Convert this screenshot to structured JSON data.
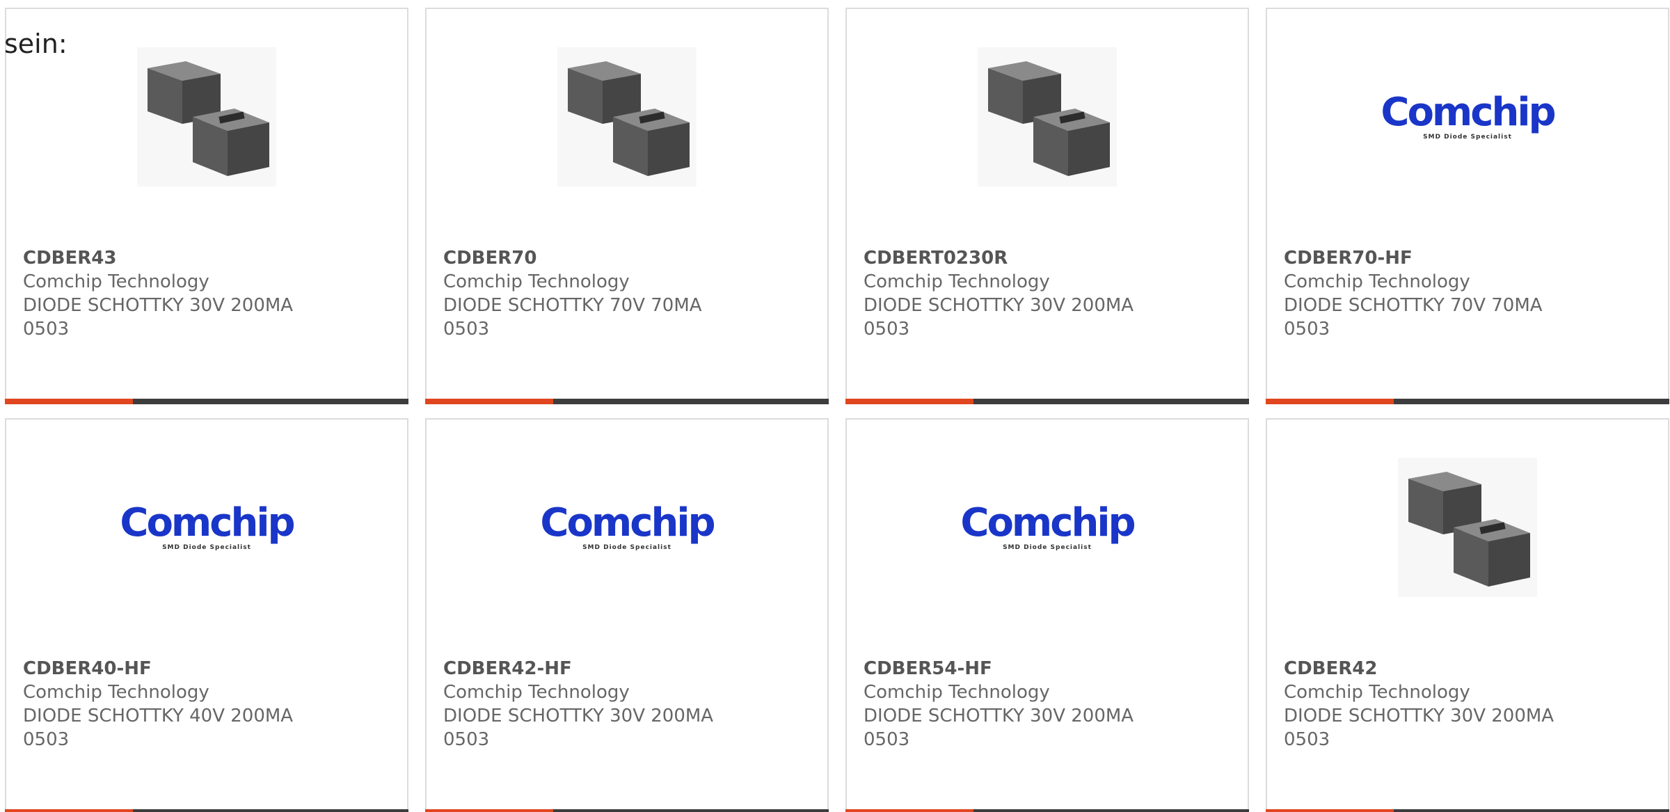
{
  "intro_text": "sein:",
  "logo": {
    "word": "Comchip",
    "tagline": "SMD Diode Specialist"
  },
  "colors": {
    "accent_bar": "#e0461f",
    "dark_bar": "#3d3d3d",
    "logo_blue": "#1a36c8"
  },
  "products": [
    {
      "part": "CDBER43",
      "maker": "Comchip Technology",
      "desc": "DIODE SCHOTTKY 30V 200MA",
      "pkg": "0503",
      "image": "diode-package-photo"
    },
    {
      "part": "CDBER70",
      "maker": "Comchip Technology",
      "desc": "DIODE SCHOTTKY 70V 70MA",
      "pkg": "0503",
      "image": "diode-package-photo"
    },
    {
      "part": "CDBERT0230R",
      "maker": "Comchip Technology",
      "desc": "DIODE SCHOTTKY 30V 200MA",
      "pkg": "0503",
      "image": "diode-package-photo"
    },
    {
      "part": "CDBER70-HF",
      "maker": "Comchip Technology",
      "desc": "DIODE SCHOTTKY 70V 70MA",
      "pkg": "0503",
      "image": "comchip-logo"
    },
    {
      "part": "CDBER40-HF",
      "maker": "Comchip Technology",
      "desc": "DIODE SCHOTTKY 40V 200MA",
      "pkg": "0503",
      "image": "comchip-logo"
    },
    {
      "part": "CDBER42-HF",
      "maker": "Comchip Technology",
      "desc": "DIODE SCHOTTKY 30V 200MA",
      "pkg": "0503",
      "image": "comchip-logo"
    },
    {
      "part": "CDBER54-HF",
      "maker": "Comchip Technology",
      "desc": "DIODE SCHOTTKY 30V 200MA",
      "pkg": "0503",
      "image": "comchip-logo"
    },
    {
      "part": "CDBER42",
      "maker": "Comchip Technology",
      "desc": "DIODE SCHOTTKY 30V 200MA",
      "pkg": "0503",
      "image": "diode-package-photo"
    }
  ]
}
